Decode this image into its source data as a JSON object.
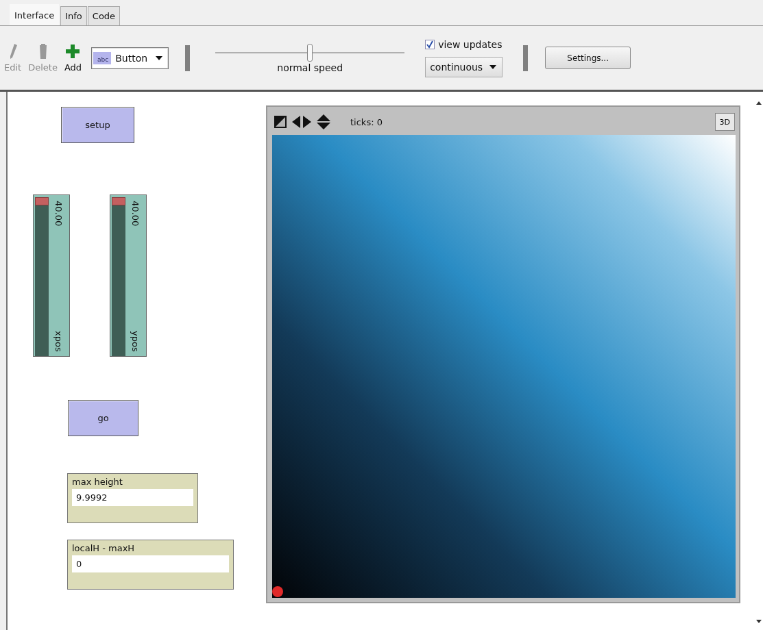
{
  "tabs": [
    {
      "label": "Interface",
      "selected": true
    },
    {
      "label": "Info",
      "selected": false
    },
    {
      "label": "Code",
      "selected": false
    }
  ],
  "toolbar": {
    "tools": [
      {
        "kind": "edit",
        "label": "Edit",
        "disabled": true
      },
      {
        "kind": "delete",
        "label": "Delete",
        "disabled": true
      },
      {
        "kind": "add",
        "label": "Add",
        "disabled": false
      }
    ],
    "widget_chooser": {
      "icon_text": "abc",
      "value": "Button"
    },
    "speed": {
      "label": "normal speed",
      "level": 0.5
    },
    "view_updates": {
      "label": "view updates",
      "checked": true
    },
    "update_mode": "continuous",
    "settings": "Settings..."
  },
  "widgets": [
    {
      "kind": "button",
      "label": "setup"
    },
    {
      "kind": "slider",
      "label": "xpos",
      "value": "40.00",
      "level": 1
    },
    {
      "kind": "slider",
      "label": "ypos",
      "value": "40.00",
      "level": 1
    },
    {
      "kind": "button",
      "label": "go"
    },
    {
      "kind": "monitor",
      "label": "max height",
      "value": "9.9992"
    },
    {
      "kind": "monitor",
      "label": "localH - maxH",
      "value": "0"
    }
  ],
  "view": {
    "ticks": "ticks: 0",
    "button_3d": "3D"
  }
}
